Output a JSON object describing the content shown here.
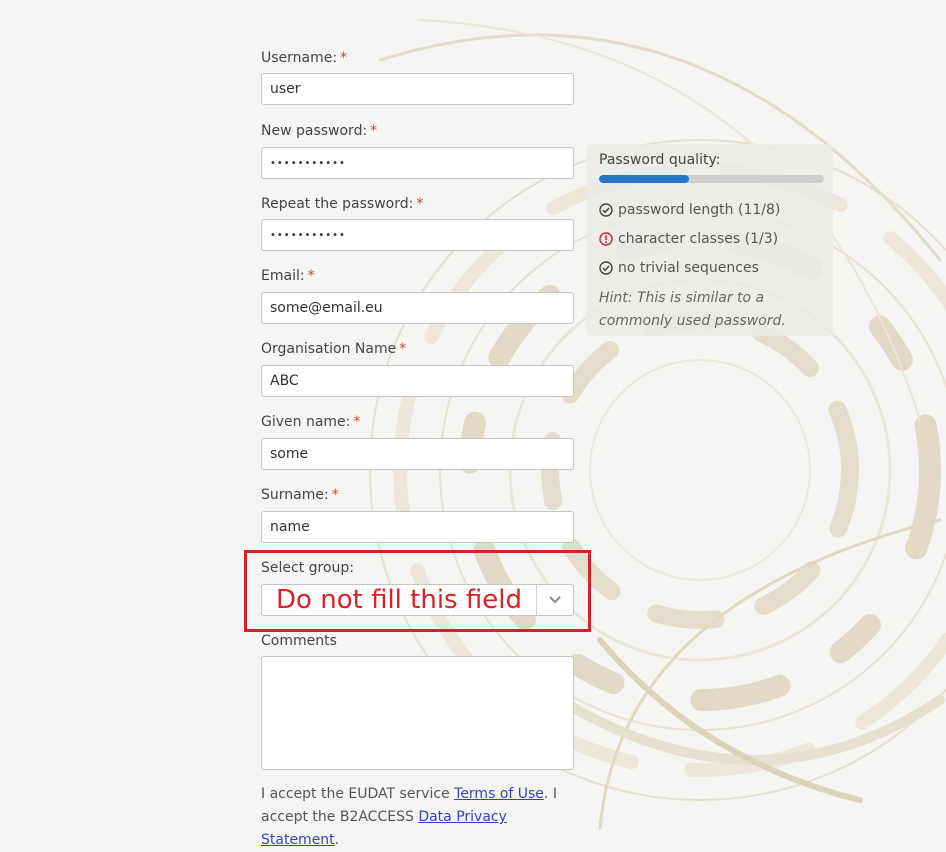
{
  "form": {
    "username": {
      "label": "Username:",
      "required": "*",
      "value": "user"
    },
    "new_password": {
      "label": "New password:",
      "required": "*",
      "value": "•••••••••••"
    },
    "repeat_password": {
      "label": "Repeat the password:",
      "required": "*",
      "value": "•••••••••••"
    },
    "email": {
      "label": "Email:",
      "required": "*",
      "value": "some@email.eu"
    },
    "organisation": {
      "label": "Organisation Name",
      "required": "*",
      "value": "ABC"
    },
    "given_name": {
      "label": "Given name:",
      "required": "*",
      "value": "some"
    },
    "surname": {
      "label": "Surname:",
      "required": "*",
      "value": "name"
    },
    "select_group": {
      "label": "Select group:",
      "value": "Do not fill this field"
    },
    "comments": {
      "label": "Comments",
      "value": ""
    },
    "terms": {
      "prefix": "I accept the EUDAT service ",
      "terms_link": "Terms of Use",
      "middle": ". I accept the B2ACCESS ",
      "privacy_link": "Data Privacy Statement",
      "suffix": "."
    }
  },
  "password_quality": {
    "title": "Password quality:",
    "progress": 0.4,
    "checks": [
      {
        "label": "password length (11/8)",
        "status": "ok",
        "icon": "check-circle-icon"
      },
      {
        "label": "character classes (1/3)",
        "status": "error",
        "icon": "exclamation-circle-icon"
      },
      {
        "label": "no trivial sequences",
        "status": "ok",
        "icon": "check-circle-icon"
      }
    ],
    "hint": "Hint: This is similar to a commonly used password."
  },
  "colors": {
    "required": "#d6402f",
    "annotation": "#d6202a",
    "progress": "#2777c9",
    "link": "#3344bb"
  }
}
